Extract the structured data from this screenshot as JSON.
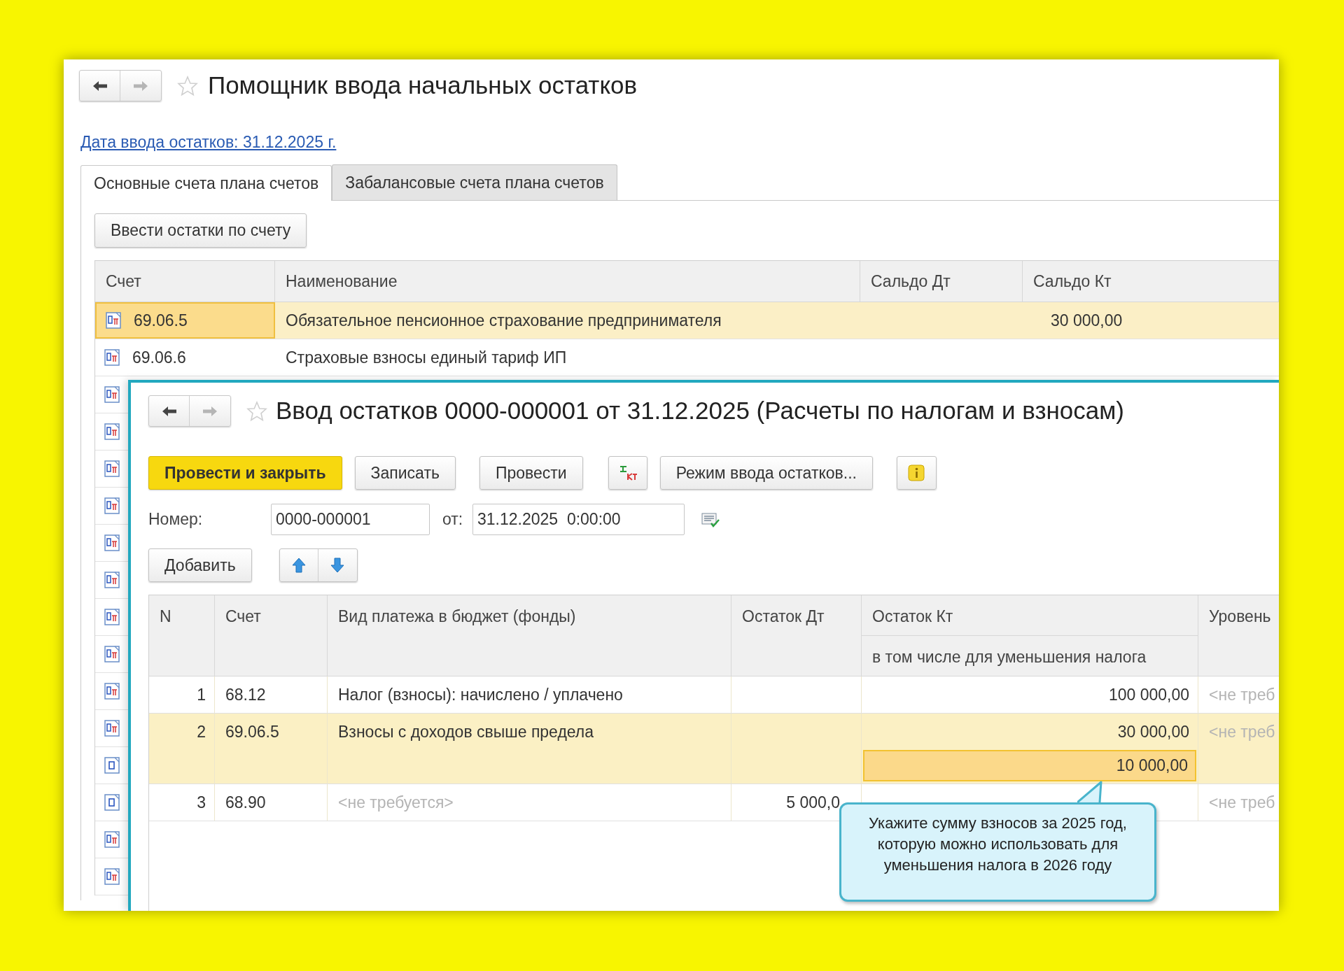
{
  "outer_window": {
    "title": "Помощник ввода начальных остатков",
    "nav": {
      "back_disabled": false,
      "forward_disabled": true
    },
    "date_link": "Дата ввода остатков: 31.12.2025 г.",
    "tabs": [
      {
        "label": "Основные счета плана счетов",
        "selected": true
      },
      {
        "label": "Забалансовые счета плана счетов",
        "selected": false
      }
    ],
    "action_button": "Ввести остатки по счету",
    "table": {
      "columns": [
        "Счет",
        "Наименование",
        "Сальдо Дт",
        "Сальдо Кт"
      ],
      "rows": [
        {
          "kind": "active_passive",
          "account": "69.06.5",
          "name": "Обязательное пенсионное страхование предпринимателя",
          "credit": "30 000,00",
          "selected": true
        },
        {
          "kind": "active_passive",
          "account": "69.06.6",
          "name": "Страховые взносы единый тариф ИП",
          "selected": false
        }
      ],
      "covered_rows": [
        {
          "kind": "active_passive"
        },
        {
          "kind": "active_passive"
        },
        {
          "kind": "active_passive"
        },
        {
          "kind": "active_passive"
        },
        {
          "kind": "active_passive"
        },
        {
          "kind": "active_passive"
        },
        {
          "kind": "active_passive"
        },
        {
          "kind": "active_passive"
        },
        {
          "kind": "active_passive"
        },
        {
          "kind": "active_passive"
        },
        {
          "kind": "active"
        },
        {
          "kind": "active"
        },
        {
          "kind": "active_passive"
        },
        {
          "kind": "active_passive"
        }
      ]
    }
  },
  "document_window": {
    "title": "Ввод остатков 0000-000001 от 31.12.2025 (Расчеты по налогам и взносам)",
    "nav": {
      "back_disabled": false,
      "forward_disabled": true
    },
    "toolbar": [
      {
        "kind": "primary",
        "label": "Провести и закрыть"
      },
      {
        "kind": "text",
        "label": "Записать"
      },
      {
        "kind": "text",
        "label": "Провести"
      },
      {
        "kind": "dtkt"
      },
      {
        "kind": "text",
        "label": "Режим ввода остатков..."
      },
      {
        "kind": "info"
      }
    ],
    "number_label": "Номер:",
    "number_value": "0000-000001",
    "date_label": "от:",
    "date_value": "31.12.2025  0:00:00",
    "add_button": "Добавить",
    "table": {
      "columns": [
        "N",
        "Счет",
        "Вид платежа в бюджет (фонды)",
        "Остаток Дт",
        "Остаток Кт",
        "Уровень"
      ],
      "credit_subheader": "в том числе для уменьшения налога",
      "rows": [
        {
          "n": "1",
          "account": "68.12",
          "payment_type": "Налог (взносы): начислено / уплачено",
          "payment_type_muted": false,
          "credit": "100 000,00",
          "column_6": "<не треб",
          "selected": false
        },
        {
          "n": "2",
          "account": "69.06.5",
          "payment_type": "Взносы с доходов свыше предела",
          "payment_type_muted": false,
          "credit": "30 000,00",
          "credit_reduction": "10 000,00",
          "reduction_focused": true,
          "column_6": "<не треб",
          "selected": true
        },
        {
          "n": "3",
          "account": "68.90",
          "payment_type": "<не требуется>",
          "payment_type_muted": true,
          "debit": "5 000,0",
          "column_6": "<не треб",
          "selected": false
        }
      ]
    },
    "callout": "Укажите сумму взносов за 2025 год, которую можно использовать для уменьшения налога в 2026 году"
  }
}
